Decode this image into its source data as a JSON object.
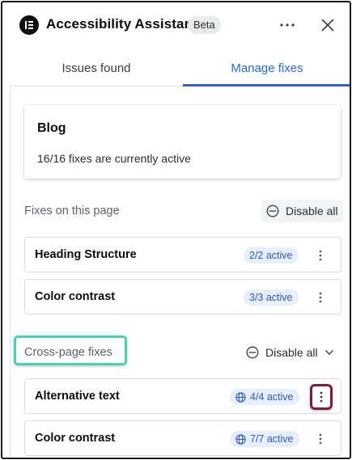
{
  "header": {
    "logo_icon": "elementor-logo-icon",
    "title": "Accessibility Assistant",
    "badge": "Beta",
    "more_icon": "more-horizontal-icon",
    "close_icon": "close-icon"
  },
  "tabs": [
    {
      "label": "Issues found",
      "active": false
    },
    {
      "label": "Manage fixes",
      "active": true
    }
  ],
  "summary": {
    "title": "Blog",
    "subtitle": "16/16 fixes are currently active"
  },
  "page_section": {
    "title": "Fixes on this page",
    "disable_label": "Disable all",
    "items": [
      {
        "name": "Heading Structure",
        "status": "2/2 active"
      },
      {
        "name": "Color contrast",
        "status": "3/3 active"
      }
    ]
  },
  "cross_section": {
    "title": "Cross-page fixes",
    "disable_label": "Disable all",
    "items": [
      {
        "name": "Alternative text",
        "status": "4/4 active",
        "icon": "globe-icon"
      },
      {
        "name": "Color contrast",
        "status": "7/7 active",
        "icon": "globe-icon"
      }
    ]
  },
  "colors": {
    "accent": "#2f62d2",
    "badge_bg": "#e7eefc",
    "highlight_teal": "#48d1b4",
    "highlight_maroon": "#7c1d3e"
  }
}
